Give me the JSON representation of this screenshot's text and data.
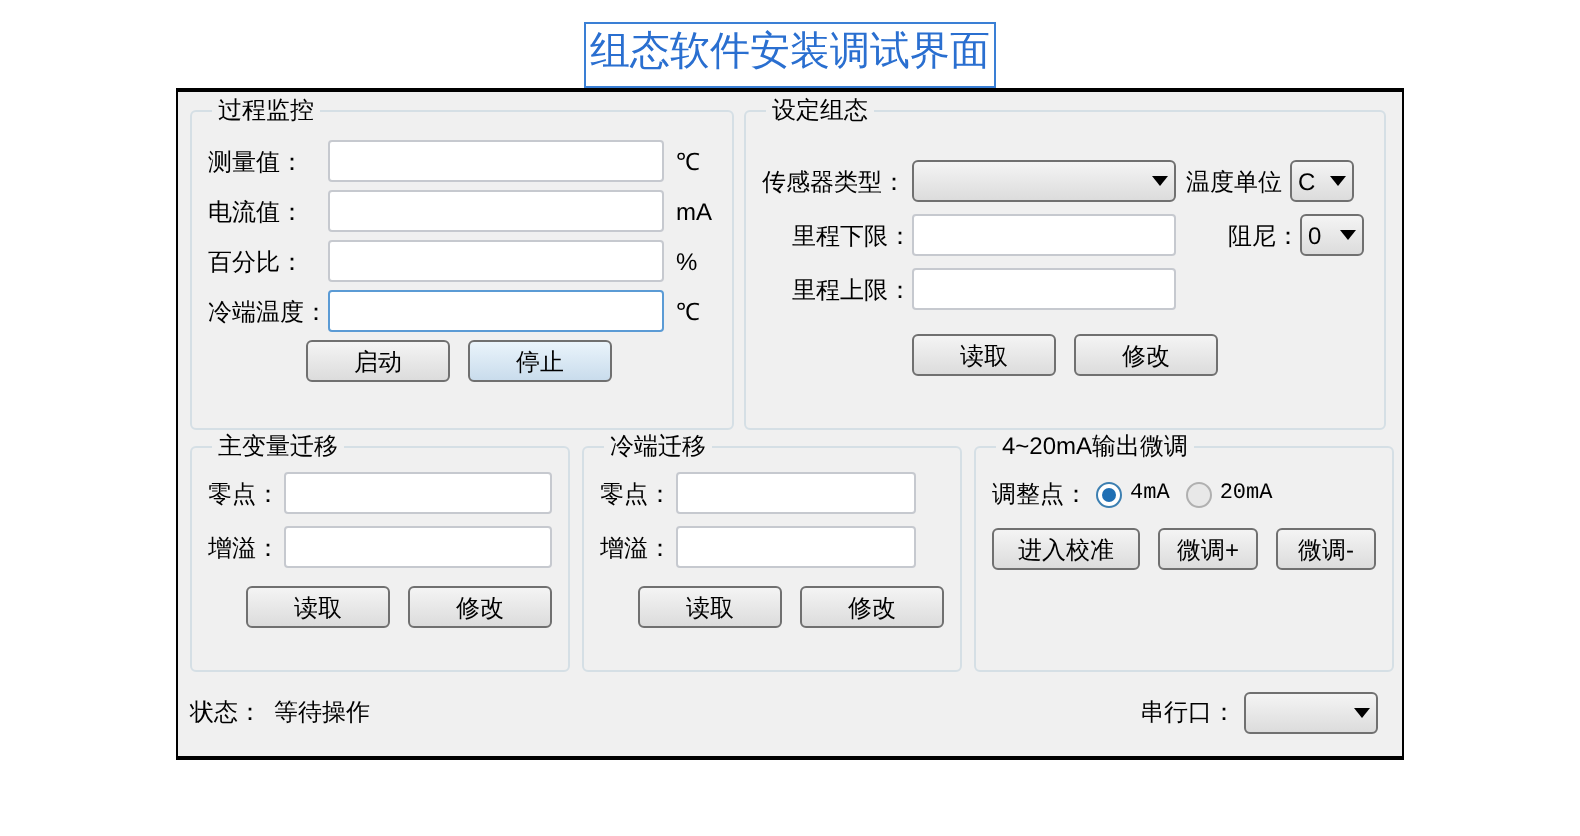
{
  "title": "组态软件安装调试界面",
  "process_monitor": {
    "title": "过程监控",
    "fields": [
      {
        "label": "测量值：",
        "unit": "℃",
        "focused": false
      },
      {
        "label": "电流值：",
        "unit": "mA",
        "focused": false
      },
      {
        "label": "百分比：",
        "unit": "%",
        "focused": false
      },
      {
        "label": "冷端温度：",
        "unit": "℃",
        "focused": true
      }
    ],
    "buttons": [
      {
        "label": "启动",
        "highlighted": false
      },
      {
        "label": "停止",
        "highlighted": true
      }
    ]
  },
  "config": {
    "title": "设定组态",
    "sensor_type_label": "传感器类型：",
    "temp_unit_label": "温度单位",
    "temp_unit_value": "C",
    "lower_label": "里程下限：",
    "upper_label": "里程上限：",
    "damping_label": "阻尼：",
    "damping_value": "0",
    "buttons": [
      "读取",
      "修改"
    ]
  },
  "pv_shift": {
    "title": "主变量迁移",
    "zero_label": "零点：",
    "gain_label": "增溢：",
    "buttons": [
      "读取",
      "修改"
    ]
  },
  "cj_shift": {
    "title": "冷端迁移",
    "zero_label": "零点：",
    "gain_label": "增溢：",
    "buttons": [
      "读取",
      "修改"
    ]
  },
  "output_trim": {
    "title": "4~20mA输出微调",
    "point_label": "调整点：",
    "options": [
      {
        "label": "4mA",
        "selected": true
      },
      {
        "label": "20mA",
        "selected": false
      }
    ],
    "buttons": [
      "进入校准",
      "微调+",
      "微调-"
    ]
  },
  "status": {
    "label": "状态：",
    "value": "等待操作"
  },
  "serial": {
    "label": "串行口："
  }
}
